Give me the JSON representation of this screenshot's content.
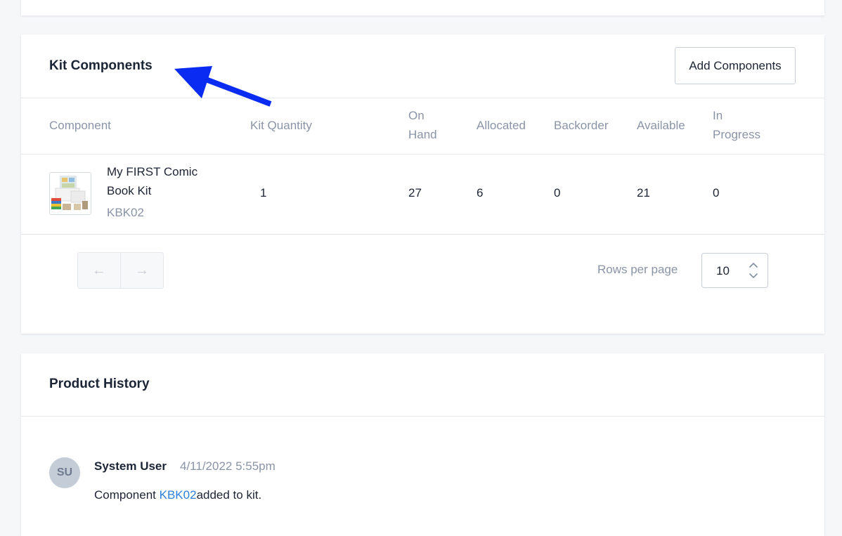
{
  "kit_components": {
    "title": "Kit Components",
    "add_button_label": "Add Components",
    "columns": {
      "component": "Component",
      "kit_quantity": "Kit Quantity",
      "on_hand": [
        "On",
        "Hand"
      ],
      "allocated": "Allocated",
      "backorder": "Backorder",
      "available": "Available",
      "in_progress": [
        "In",
        "Progress"
      ]
    },
    "rows": [
      {
        "name": "My FIRST Comic Book Kit",
        "sku": "KBK02",
        "kit_quantity": "1",
        "on_hand": "27",
        "allocated": "6",
        "backorder": "0",
        "available": "21",
        "in_progress": "0"
      }
    ],
    "pagination": {
      "prev_icon": "←",
      "next_icon": "→",
      "rows_per_page_label": "Rows per page",
      "rows_per_page_value": "10"
    }
  },
  "product_history": {
    "title": "Product History",
    "entries": [
      {
        "initials": "SU",
        "author": "System User",
        "timestamp": "4/11/2022 5:55pm",
        "message_prefix": "Component ",
        "message_link": "KBK02",
        "message_suffix": "added to kit."
      }
    ]
  },
  "colors": {
    "annotation_arrow": "#0a2cf2",
    "link": "#2d7fd8",
    "muted_text": "#8a94a6",
    "avatar_bg": "#c4ccd8"
  }
}
